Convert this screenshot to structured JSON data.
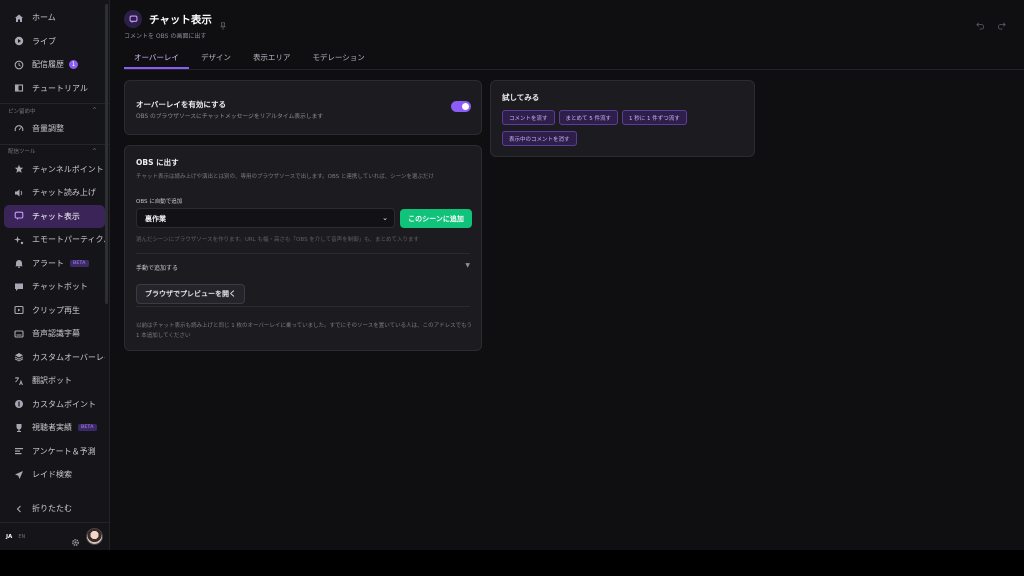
{
  "sidebar": {
    "items_top": [
      {
        "label": "ホーム",
        "icon": "home-icon"
      },
      {
        "label": "ライブ",
        "icon": "play-circle-icon"
      },
      {
        "label": "配信履歴",
        "icon": "history-icon",
        "badge": "1"
      },
      {
        "label": "チュートリアル",
        "icon": "book-icon"
      }
    ],
    "section_pinned": "ピン留め中",
    "items_pinned": [
      {
        "label": "音量調整",
        "icon": "gauge-icon"
      }
    ],
    "section_tools": "配信ツール",
    "items_tools": [
      {
        "label": "チャンネルポイント",
        "icon": "star-icon"
      },
      {
        "label": "チャット読み上げ",
        "icon": "speaker-icon"
      },
      {
        "label": "チャット表示",
        "icon": "chat-icon",
        "active": true
      },
      {
        "label": "エモートパーティクル",
        "icon": "sparkle-icon"
      },
      {
        "label": "アラート",
        "icon": "bell-icon",
        "beta": "BETA"
      },
      {
        "label": "チャットボット",
        "icon": "message-icon"
      },
      {
        "label": "クリップ再生",
        "icon": "clip-icon"
      },
      {
        "label": "音声認識字幕",
        "icon": "caption-icon"
      },
      {
        "label": "カスタムオーバーレイ",
        "icon": "layers-icon"
      },
      {
        "label": "翻訳ボット",
        "icon": "translate-icon"
      },
      {
        "label": "カスタムポイント",
        "icon": "coin-icon"
      },
      {
        "label": "視聴者実績",
        "icon": "trophy-icon",
        "beta": "BETA"
      },
      {
        "label": "アンケート＆予測",
        "icon": "poll-icon"
      },
      {
        "label": "レイド検索",
        "icon": "send-icon"
      }
    ],
    "collapse_label": "折りたたむ",
    "lang_active": "JA",
    "lang_other": "EN"
  },
  "header": {
    "title": "チャット表示",
    "subtitle": "コメントを OBS の画面に出す"
  },
  "tabs": [
    "オーバーレイ",
    "デザイン",
    "表示エリア",
    "モデレーション"
  ],
  "overlay_card": {
    "title": "オーバーレイを有効にする",
    "description": "OBS のブラウザソースにチャットメッセージをリアルタイム表示します",
    "enabled": true
  },
  "obs_card": {
    "title": "OBS に出す",
    "description": "チャット表示は読み上げや演出とは別の、専用のブラウザソースで出します。OBS と連携していれば、シーンを選ぶだけ",
    "auto_label": "OBS に自動で追加",
    "scene_value": "裏作業",
    "add_button": "このシーンに追加",
    "hint": "選んだシーンにブラウザソースを作ります。URL も幅・高さも「OBS を介して音声を制御」も、まとめて入ります",
    "manual_label": "手動で追加する",
    "preview_button": "ブラウザでプレビューを開く",
    "note": "以前はチャット表示も読み上げと同じ 1 枚のオーバーレイに乗っていました。すでにそのソースを置いている人は、このアドレスでもう 1 本追加してください"
  },
  "try_card": {
    "title": "試してみる",
    "buttons": [
      "コメントを流す",
      "まとめて 5 件流す",
      "1 秒に 1 件ずつ流す",
      "表示中のコメントを消す"
    ]
  },
  "colors": {
    "accent": "#8b5cf6",
    "success": "#10c27a",
    "background": "#0f0f12",
    "card": "#1b1b20"
  }
}
